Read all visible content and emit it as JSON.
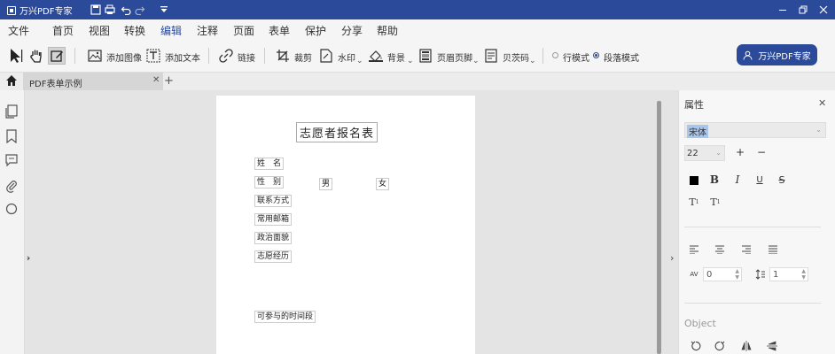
{
  "app": {
    "title": "万兴PDF专家",
    "brand_color": "#2b4a9a"
  },
  "quick_access": [
    "save-icon",
    "print-icon",
    "undo-icon",
    "redo-icon",
    "customize-dropdown-icon"
  ],
  "window_controls": [
    "minimize-icon",
    "restore-icon",
    "close-icon"
  ],
  "menu": {
    "items": [
      "文件",
      "首页",
      "视图",
      "转换",
      "编辑",
      "注释",
      "页面",
      "表单",
      "保护",
      "分享",
      "帮助"
    ],
    "active": "编辑"
  },
  "toolbar": {
    "add_image": "添加图像",
    "add_text": "添加文本",
    "link": "链接",
    "crop": "裁剪",
    "watermark": "水印",
    "background": "背景",
    "header_footer": "页眉页脚",
    "bates": "贝茨码",
    "line_mode": "行模式",
    "paragraph_mode": "段落模式",
    "mode_selected": "段落模式",
    "expert_button": "万兴PDF专家"
  },
  "tabs": {
    "document": "PDF表单示例"
  },
  "document": {
    "title": "志愿者报名表",
    "fields": {
      "name": "姓　名",
      "gender": "性　别",
      "male": "男",
      "female": "女",
      "contact": "联系方式",
      "email": "常用邮箱",
      "politics": "政治面貌",
      "experience": "志愿经历",
      "availability": "可参与的时间段"
    }
  },
  "properties": {
    "title": "属性",
    "font": "宋体",
    "size": "22",
    "char_spacing": "0",
    "line_spacing": "1",
    "object_label": "Object"
  }
}
